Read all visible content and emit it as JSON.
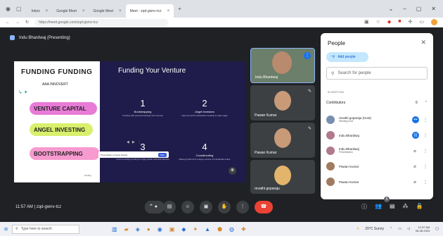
{
  "browser": {
    "tabs": [
      {
        "label": "Inbox",
        "active": false
      },
      {
        "label": "Google Meet",
        "active": false
      },
      {
        "label": "Google Meet",
        "active": false
      },
      {
        "label": "Meet - zqd-gwnv-tcz",
        "active": true
      }
    ],
    "url": "https://meet.google.com/zqd-gwnv-tcz"
  },
  "meet": {
    "presenting_label": "Indu Bhardwaj (Presenting)",
    "time_code": "11:57 AM | zqd-gwnv-tcz"
  },
  "slide": {
    "left_title": "FUNDING FUNDING",
    "left_subtitle": "AAA INNOVERT",
    "pills": [
      "VENTURE CAPITAL",
      "ANGEL INVESTING",
      "BOOTSTRAPPING"
    ],
    "left_footer": "funding",
    "title": "Funding Your Venture",
    "cells": [
      {
        "num": "1",
        "title": "Bootstrapping",
        "desc": "Funding with personal savings and revenue"
      },
      {
        "num": "2",
        "title": "Angel Investors",
        "desc": "High net worth individuals investing in early stage"
      },
      {
        "num": "3",
        "title": "Venture Capital",
        "desc": "Firms providing funding for high growth potential startups"
      },
      {
        "num": "4",
        "title": "Crowdfunding",
        "desc": "Raising funds from a large number of individuals online"
      }
    ],
    "popup_text": "Presentation is being shared",
    "popup_button": "Stop"
  },
  "tiles": [
    {
      "name": "Indu Bhardwaj"
    },
    {
      "name": "Pawan Kumar"
    },
    {
      "name": "Pawan Kumar"
    },
    {
      "name": "revathi goparaju"
    }
  ],
  "people": {
    "title": "People",
    "add_label": "Add people",
    "search_placeholder": "Search for people",
    "in_section_label": "IN MEETING",
    "contributors_label": "Contributors",
    "contributors_count": "6",
    "list": [
      {
        "name": "revathi goparaju (Host)",
        "role": "Meeting host"
      },
      {
        "name": "Indu Bhardwaj",
        "role": ""
      },
      {
        "name": "Indu Bhardwaj",
        "role": "Presentation"
      },
      {
        "name": "Pawan Kumar",
        "role": ""
      },
      {
        "name": "Pawan Kumar",
        "role": ""
      }
    ]
  },
  "controls_badge": "6",
  "taskbar": {
    "search_placeholder": "Type here to search",
    "weather": "29°C Sunny",
    "time": "11:57 AM",
    "date": "06-08-2023"
  }
}
